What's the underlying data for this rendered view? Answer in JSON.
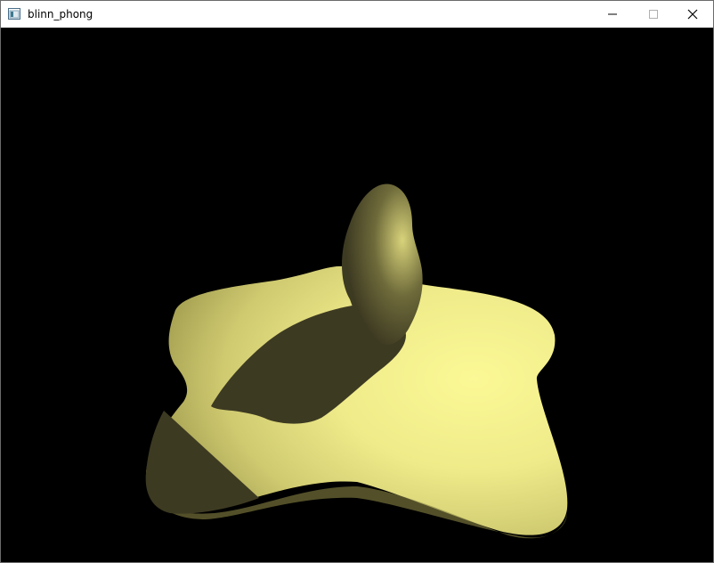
{
  "window": {
    "title": "blinn_phong",
    "icon": "app-window-icon",
    "buttons": {
      "minimize_icon": "minimize-icon",
      "maximize_icon": "maximize-icon",
      "close_icon": "close-icon"
    }
  },
  "scene": {
    "background": "#000000",
    "surface_lit": "#f3f08c",
    "surface_mid": "#c9c46a",
    "surface_shadow": "#3d3a22"
  }
}
